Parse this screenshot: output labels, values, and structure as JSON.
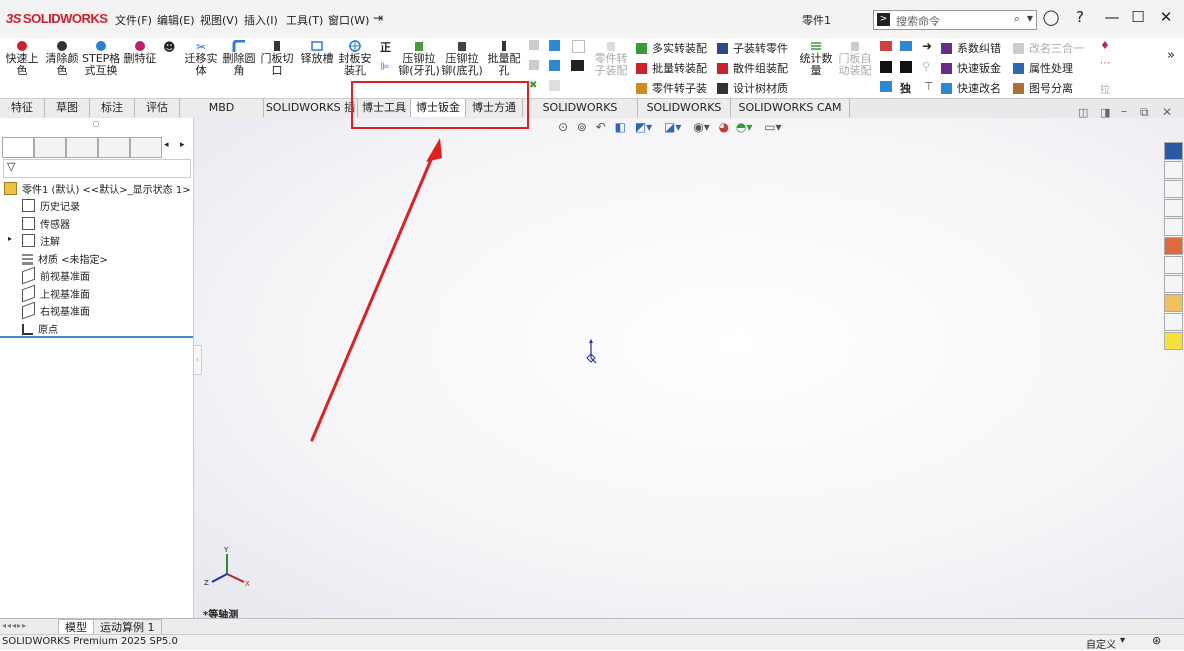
{
  "app": {
    "brand": "SOLIDWORKS",
    "brand_prefix": "3S"
  },
  "menu": [
    "文件(F)",
    "编辑(E)",
    "视图(V)",
    "插入(I)",
    "工具(T)",
    "窗口(W)"
  ],
  "document_title": "零件1",
  "search": {
    "placeholder": "搜索命令"
  },
  "ribbon": {
    "big_buttons": [
      {
        "label": "快速上\n色"
      },
      {
        "label": "清除颜\n色"
      },
      {
        "label": "STEP格\n式互换"
      },
      {
        "label": "删特征"
      },
      {
        "label": "迁移实\n体"
      },
      {
        "label": "删除圆\n角"
      },
      {
        "label": "门板切\n口"
      },
      {
        "label": "铎放槽"
      },
      {
        "label": "封板安\n装孔"
      },
      {
        "label": "压铆拉\n铆(牙孔)"
      },
      {
        "label": "压铆拉\n铆(底孔)"
      },
      {
        "label": "批量配\n孔"
      },
      {
        "label": "零件转\n子装配"
      },
      {
        "label": "统计数\n量"
      },
      {
        "label": "门板自\n动装配"
      }
    ],
    "small_buttons": [
      {
        "label": "多实转装配"
      },
      {
        "label": "批量转装配"
      },
      {
        "label": "零件转子装"
      },
      {
        "label": "子装转零件"
      },
      {
        "label": "散件组装配"
      },
      {
        "label": "设计树材质"
      },
      {
        "label": "独"
      },
      {
        "label": "系数纠错"
      },
      {
        "label": "快速钣金"
      },
      {
        "label": "快速改名"
      },
      {
        "label": "改名三合一"
      },
      {
        "label": "属性处理"
      },
      {
        "label": "图号分离"
      },
      {
        "label": "拉"
      }
    ]
  },
  "tabs": [
    {
      "label": "特征"
    },
    {
      "label": "草图"
    },
    {
      "label": "标注"
    },
    {
      "label": "评估"
    },
    {
      "label": "MBD Dimensions"
    },
    {
      "label": "SOLIDWORKS 插件"
    },
    {
      "label": "博士工具"
    },
    {
      "label": "博士钣金"
    },
    {
      "label": "博士方通"
    },
    {
      "label": "SOLIDWORKS Inspection"
    },
    {
      "label": "SOLIDWORKS CAM"
    },
    {
      "label": "SOLIDWORKS CAM TBM"
    }
  ],
  "tree": {
    "root": "零件1 (默认) <<默认>_显示状态 1>",
    "items": [
      "历史记录",
      "传感器",
      "注解",
      "材质 <未指定>",
      "前视基准面",
      "上视基准面",
      "右视基准面",
      "原点"
    ]
  },
  "viewport": {
    "view_label": "*等轴测",
    "axis_x": "X",
    "axis_y": "Y",
    "axis_z": "Z"
  },
  "bottom_tabs": [
    "模型",
    "运动算例 1"
  ],
  "status": {
    "version": "SOLIDWORKS Premium 2025 SP5.0",
    "custom": "自定义"
  },
  "colors": {
    "brand": "#d01f2d",
    "annotation": "#e02020"
  }
}
